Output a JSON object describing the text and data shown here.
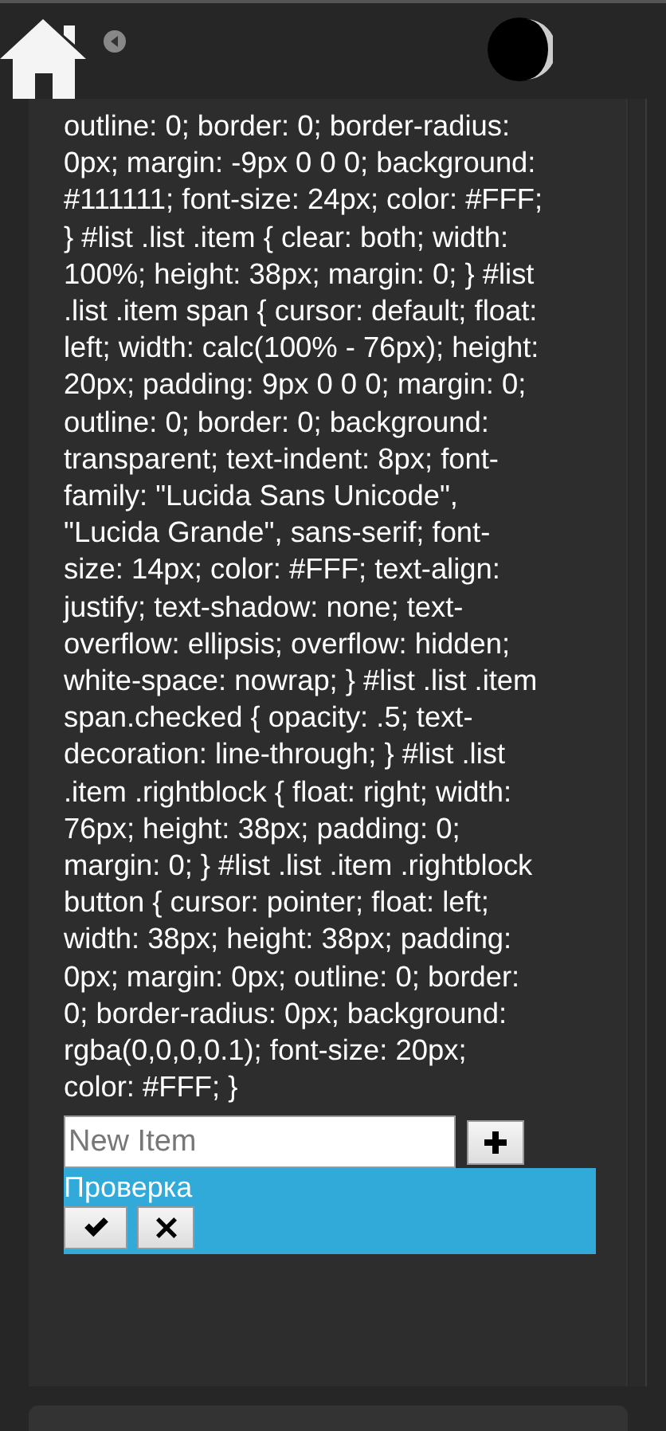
{
  "code_text": "outline: 0; border: 0; border-radius: 0px; margin: -9px 0 0 0; background: #111111; font-size: 24px; color: #FFF; } #list .list .item { clear: both; width: 100%; height: 38px; margin: 0; } #list .list .item span { cursor: default; float: left; width: calc(100% - 76px); height: 20px; padding: 9px 0 0 0; margin: 0; outline: 0; border: 0; background: transparent; text-indent: 8px; font-family: \"Lucida Sans Unicode\", \"Lucida Grande\", sans-serif; font-size: 14px; color: #FFF; text-align: justify; text-shadow: none; text-overflow: ellipsis; overflow: hidden; white-space: nowrap; } #list .list .item span.checked { opacity: .5; text-decoration: line-through; } #list .list .item .rightblock { float: right; width: 76px; height: 38px; padding: 0; margin: 0; } #list .list .item .rightblock button { cursor: pointer; float: left; width: 38px; height: 38px; padding: 0px; margin: 0px; outline: 0; border: 0; border-radius: 0px; background: rgba(0,0,0,0.1); font-size: 20px; color: #FFF; }",
  "new_item": {
    "placeholder": "New Item"
  },
  "items": [
    {
      "label": "Проверка"
    }
  ]
}
